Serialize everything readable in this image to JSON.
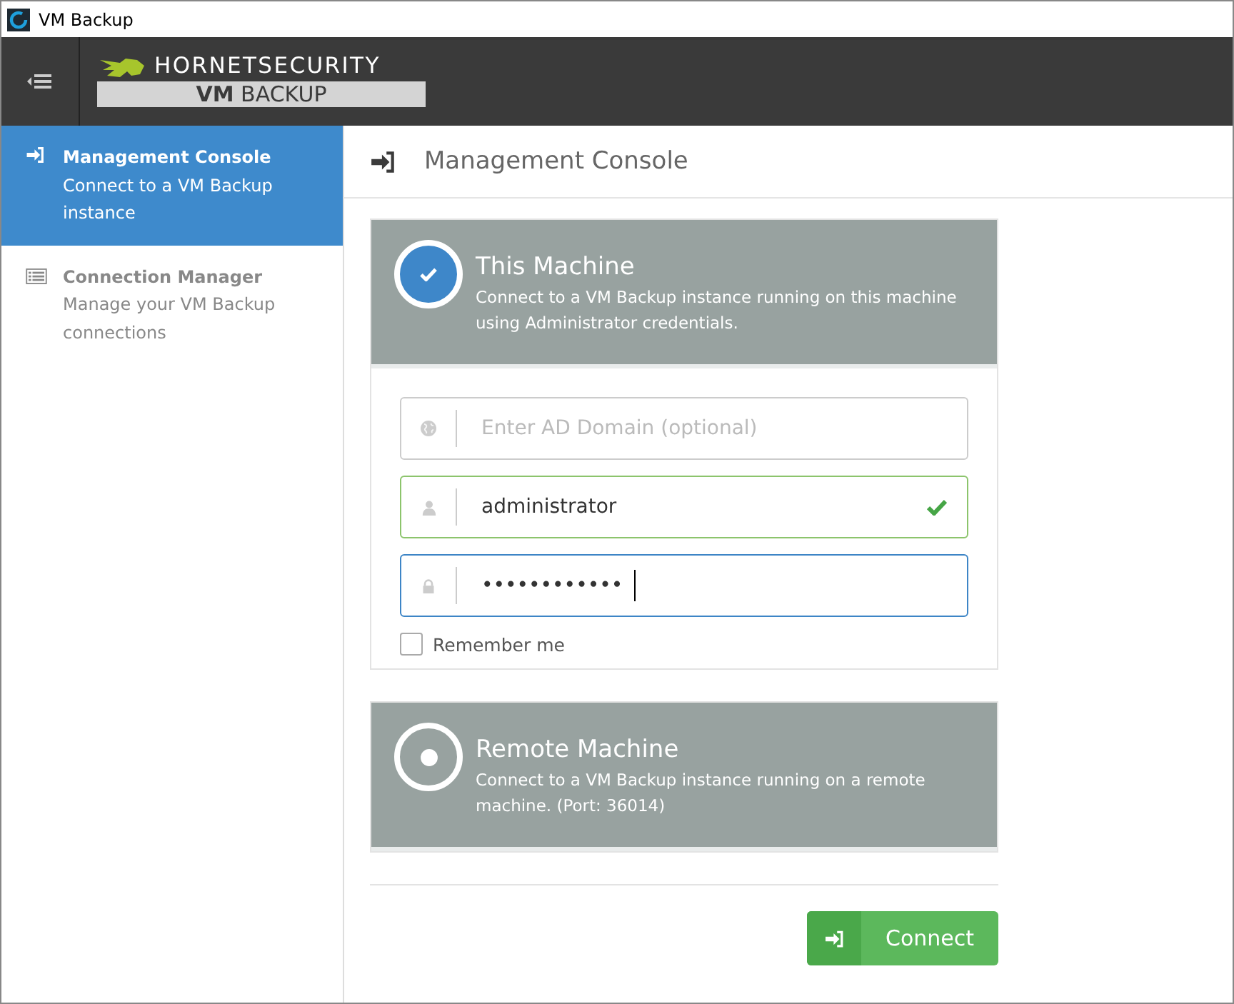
{
  "window": {
    "title": "VM Backup"
  },
  "header": {
    "brand": "HORNETSECURITY",
    "product_strong": "VM",
    "product": "BACKUP"
  },
  "sidebar": {
    "items": [
      {
        "kind": "console",
        "title": "Management Console",
        "subtitle": "Connect to a VM Backup instance",
        "selected": true
      },
      {
        "kind": "manager",
        "title": "Connection Manager",
        "subtitle": "Manage your VM Backup connections",
        "selected": false
      }
    ]
  },
  "page": {
    "title": "Management Console"
  },
  "options": [
    {
      "kind": "local",
      "title": "This Machine",
      "description": "Connect to a VM Backup instance running on this machine using Administrator credentials.",
      "selected": true,
      "fields": [
        {
          "kind": "domain",
          "placeholder": "Enter AD Domain (optional)",
          "valid": false,
          "focused": false
        },
        {
          "kind": "user",
          "value": "administrator",
          "valid": true,
          "focused": false
        },
        {
          "kind": "password",
          "value": "••••••••••••",
          "valid": false,
          "focused": true
        }
      ],
      "remember": {
        "label": "Remember me",
        "checked": false
      }
    },
    {
      "kind": "remote",
      "title": "Remote Machine",
      "description": "Connect to a VM Backup instance running on a remote machine. (Port: 36014)",
      "selected": false
    }
  ],
  "connect_button": {
    "label": "Connect"
  }
}
